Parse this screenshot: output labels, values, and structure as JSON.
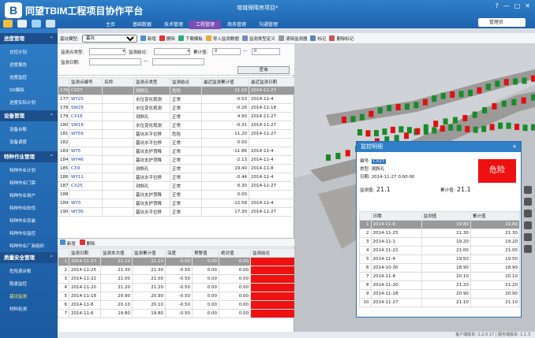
{
  "app": {
    "logo": "B",
    "title": "同望TBIM工程项目协作平台",
    "project": "增城保障房项目*",
    "user": "管理员"
  },
  "main_nav": [
    "主页",
    "基础数据",
    "技术管理",
    "工程管理",
    "商务管理",
    "沟通管理"
  ],
  "sidebar": {
    "groups": [
      {
        "label": "进度管理",
        "items": [
          "总控计划",
          "进度报告",
          "进度监控",
          "5D模拟",
          "进度实际计划"
        ]
      },
      {
        "label": "设备管理",
        "items": [
          "设备台账",
          "设备调度"
        ]
      },
      {
        "label": "特种作业管理",
        "items": [
          "特种作业计划",
          "特种作业门禁",
          "特种作业用户",
          "特种作业砍伐",
          "特种作业安装",
          "特种作业监控",
          "特种作业厂商组织"
        ]
      },
      {
        "label": "质量安全管理",
        "items": [
          "危险源台账",
          "隐患监控",
          "基坑监测",
          "材料检测"
        ]
      }
    ],
    "active_item": "基坑监测"
  },
  "toolbar": {
    "pit_label": "基坑模型:",
    "pit_value": "基坑",
    "buttons": [
      "新增",
      "删除",
      "下载模板",
      "导入监测数据",
      "监测类型定义",
      "清除监测器",
      "标记",
      "删除标记"
    ]
  },
  "filter": {
    "point_type_label": "监测点类型:",
    "conclusion_label": "监测结论:",
    "cumulative_label": "累计值:",
    "cumulative_from": "0",
    "cumulative_to": "0",
    "date_label": "监测日期:",
    "range_sep": "—",
    "query_button": "查询"
  },
  "point_table": {
    "headers": [
      "",
      "监测点编号",
      "名称",
      "监测点类型",
      "监测结论",
      "最近监测累计值",
      "最近监测日期"
    ],
    "rows": [
      [
        "176",
        "CX27",
        "",
        "测斜孔",
        "危险",
        "21.10",
        "2014-11-27"
      ],
      [
        "177",
        "WY25",
        "",
        "水位变化观测",
        "正常",
        "-0.53",
        "2014-11-4"
      ],
      [
        "178",
        "SW25",
        "",
        "水位变化观测",
        "正常",
        "-0.26",
        "2014-11-18"
      ],
      [
        "179",
        "CX16",
        "",
        "测斜孔",
        "正常",
        "4.90",
        "2014-11-27"
      ],
      [
        "180",
        "SW16",
        "",
        "水位变化观测",
        "正常",
        "-0.31",
        "2014-11-27"
      ],
      [
        "181",
        "WY59",
        "",
        "基坑水平位移",
        "危险",
        "11.20",
        "2014-11-27"
      ],
      [
        "182",
        "",
        "",
        "基坑水平位移",
        "正常",
        "0.00",
        ""
      ],
      [
        "183",
        "WY5",
        "",
        "基坑支护顶降",
        "正常",
        "-11.86",
        "2014-11-4"
      ],
      [
        "184",
        "WY46",
        "",
        "基坑支护顶降",
        "正常",
        "-2.13",
        "2014-11-4"
      ],
      [
        "185",
        "CX9",
        "",
        "测斜孔",
        "正常",
        "19.40",
        "2014-11-8"
      ],
      [
        "186",
        "WY11",
        "",
        "基坑水平位移",
        "正常",
        "-0.44",
        "2014-11-4"
      ],
      [
        "187",
        "CX25",
        "",
        "测斜孔",
        "正常",
        "6.30",
        "2014-11-27"
      ],
      [
        "188",
        "",
        "",
        "基坑支护顶降",
        "正常",
        "0.00",
        ""
      ],
      [
        "189",
        "WY3",
        "",
        "基坑支护顶降",
        "正常",
        "-12.58",
        "2014-11-4"
      ],
      [
        "190",
        "WY36",
        "",
        "基坑水平位移",
        "正常",
        "17.30",
        "2014-11-27"
      ]
    ],
    "selected_index": 0
  },
  "record_toolbar": {
    "add": "新增",
    "delete": "删除"
  },
  "record_table": {
    "headers": [
      "",
      "监测日期",
      "监测本次值",
      "监测累计值",
      "深度",
      "预警值",
      "绝对值",
      "监测结论"
    ],
    "rows": [
      [
        "1",
        "2014-11-27",
        "21.10",
        "21.10",
        "-0.50",
        "0.00",
        "0.00",
        ""
      ],
      [
        "2",
        "2014-11-25",
        "21.30",
        "21.30",
        "-0.50",
        "0.00",
        "0.00",
        ""
      ],
      [
        "3",
        "2014-11-22",
        "21.00",
        "21.00",
        "-0.50",
        "0.00",
        "0.00",
        ""
      ],
      [
        "4",
        "2014-11-20",
        "21.20",
        "21.20",
        "-0.50",
        "0.00",
        "0.00",
        ""
      ],
      [
        "5",
        "2014-11-18",
        "20.90",
        "20.90",
        "-0.50",
        "0.00",
        "0.00",
        ""
      ],
      [
        "6",
        "2014-11-8",
        "20.10",
        "20.10",
        "-0.50",
        "0.00",
        "0.00",
        ""
      ],
      [
        "7",
        "2014-11-6",
        "19.80",
        "19.80",
        "-0.50",
        "0.00",
        "0.00",
        ""
      ]
    ],
    "status_color": "#ee1111"
  },
  "popup": {
    "title": "监控明细",
    "close": "×",
    "code_label": "编号:",
    "code": "CX27",
    "type_label": "类型:",
    "type": "测斜孔",
    "date_label": "日期:",
    "date": "2014-11-27 0:00:00",
    "current_label": "监测值:",
    "current": "21.1",
    "cumulative_label": "累计值:",
    "cumulative": "21.1",
    "status": "危险",
    "table_headers": [
      "",
      "日期",
      "监测值",
      "累计值"
    ],
    "rows": [
      [
        "1",
        "2014-11-6",
        "19.80",
        "19.80"
      ],
      [
        "2",
        "2014-11-25",
        "21.30",
        "21.30"
      ],
      [
        "3",
        "2014-11-1",
        "19.20",
        "19.20"
      ],
      [
        "4",
        "2014-11-22",
        "21.00",
        "21.00"
      ],
      [
        "5",
        "2014-11-4",
        "19.50",
        "19.50"
      ],
      [
        "6",
        "2014-10-30",
        "18.90",
        "18.90"
      ],
      [
        "7",
        "2014-11-8",
        "20.10",
        "20.10"
      ],
      [
        "8",
        "2014-11-20",
        "21.20",
        "21.20"
      ],
      [
        "9",
        "2014-11-18",
        "20.90",
        "20.90"
      ],
      [
        "10",
        "2014-11-27",
        "21.10",
        "21.10"
      ]
    ]
  },
  "status_bar": "客户端版本: 1.2.0.17 | 服务端版本: 1.1.3"
}
